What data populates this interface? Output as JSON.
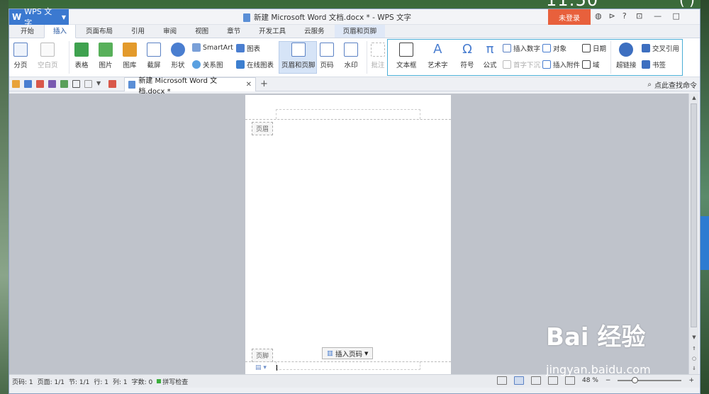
{
  "clock": "11:50",
  "app": {
    "name": "WPS 文字",
    "logo": "W",
    "doc_title": "新建 Microsoft Word 文档.docx * - WPS 文字",
    "login": "未登录",
    "title_icons": [
      "skin-icon",
      "share-icon",
      "help-icon"
    ]
  },
  "menu_tabs": [
    "开始",
    "插入",
    "页面布局",
    "引用",
    "审阅",
    "视图",
    "章节",
    "开发工具",
    "云服务",
    "页眉和页脚"
  ],
  "ribbon": {
    "page_break": "分页",
    "blank_page": "空白页",
    "table": "表格",
    "picture": "图片",
    "gallery": "图库",
    "screenshot": "截屏",
    "shapes": "形状",
    "smartart": "SmartArt",
    "chart": "图表",
    "relation": "关系图",
    "online_chart": "在线图表",
    "header_footer": "页眉和页脚",
    "page_number": "页码",
    "watermark": "水印",
    "comment": "批注",
    "textbox": "文本框",
    "wordart": "艺术字",
    "symbol": "符号",
    "formula": "公式",
    "insert_number": "插入数字",
    "drop_cap": "首字下沉",
    "object": "对象",
    "attachment": "插入附件",
    "date": "日期",
    "field": "域",
    "hyperlink": "超链接",
    "crossref": "交叉引用",
    "bookmark": "书签"
  },
  "quickbar": {
    "doc_tab": "新建 Microsoft Word 文档.docx *",
    "find_command": "点此查找命令"
  },
  "page": {
    "header_label": "页眉",
    "footer_label": "页脚",
    "insert_page_number": "插入页码"
  },
  "status": {
    "page": "页码: 1",
    "pages": "页面: 1/1",
    "section": "节: 1/1",
    "row": "行: 1",
    "col": "列: 1",
    "words": "字数: 0",
    "spell": "拼写检查",
    "zoom": "48 %"
  },
  "watermark": {
    "brand": "Bai 经验",
    "url": "jingyan.baidu.com"
  }
}
